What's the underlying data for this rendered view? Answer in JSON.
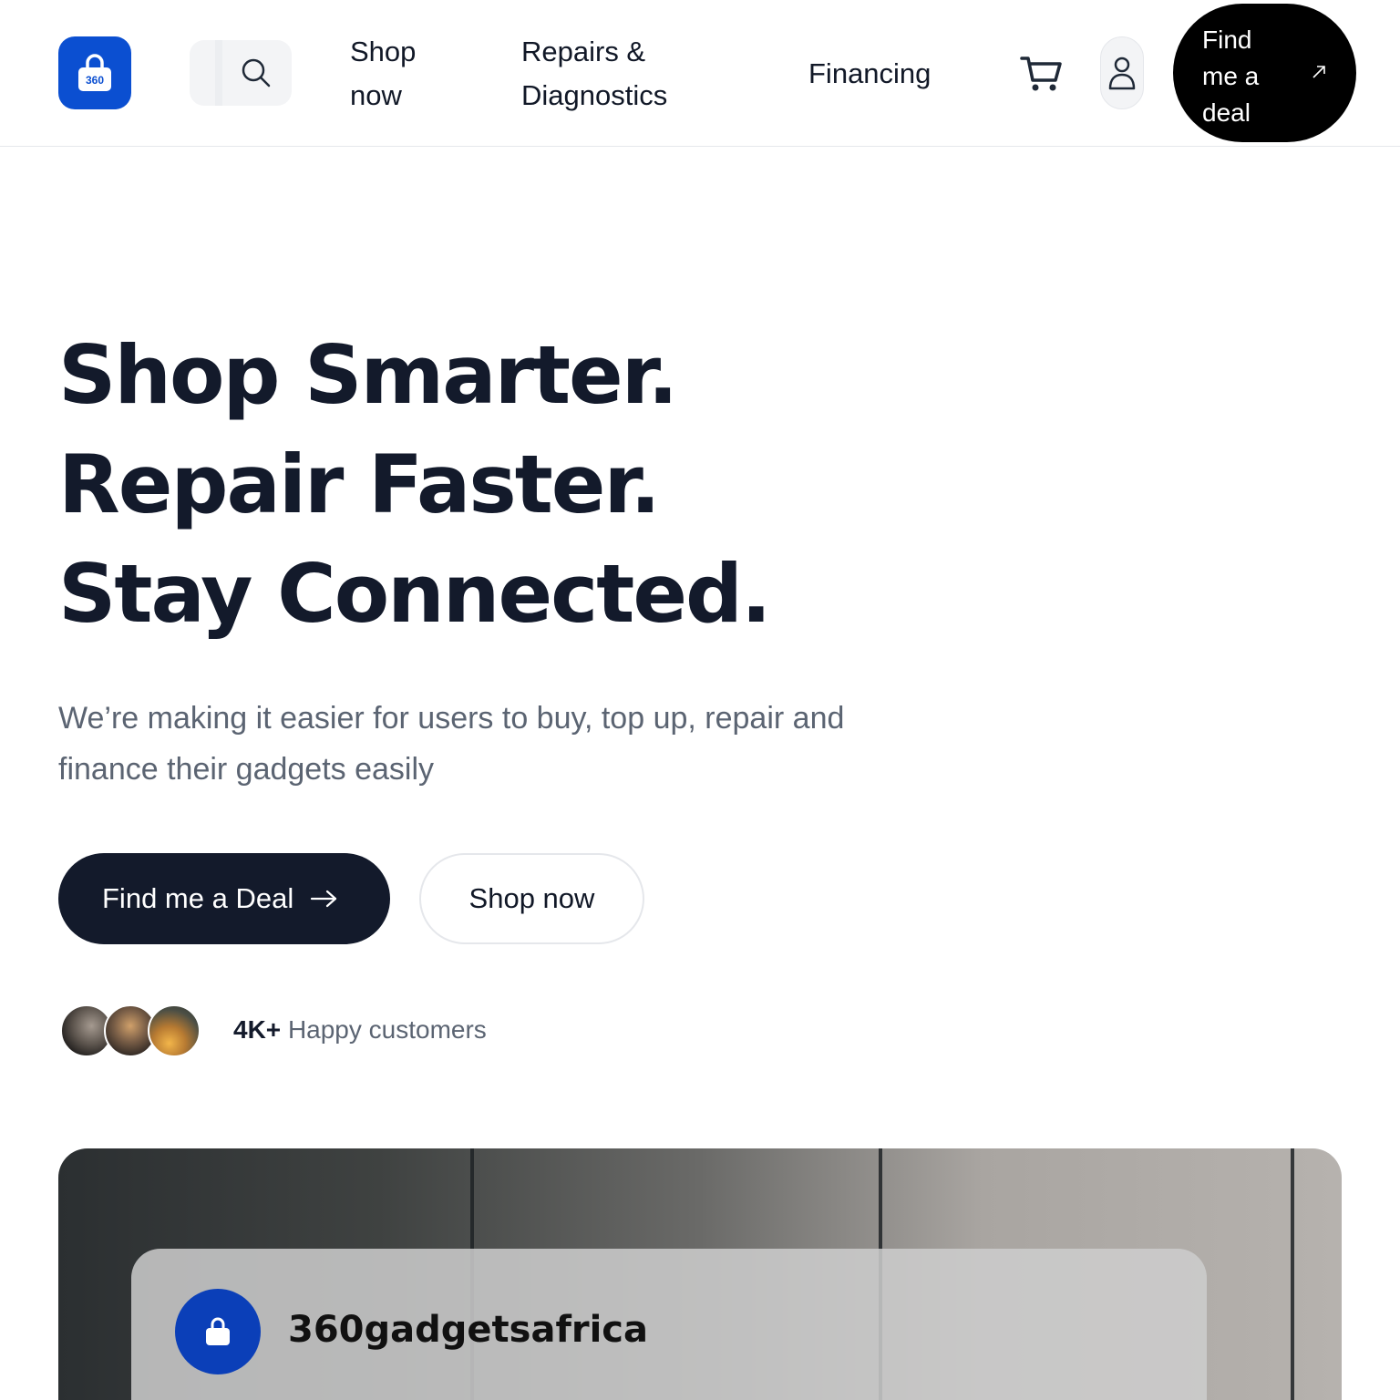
{
  "header": {
    "logo_text": "360",
    "nav": {
      "shop_now": "Shop now",
      "repairs": "Repairs & Diagnostics",
      "financing": "Financing"
    },
    "deal_button": "Find me a deal"
  },
  "hero": {
    "headline": [
      "Shop Smarter.",
      "Repair Faster.",
      "Stay Connected."
    ],
    "subtitle": "We’re making it easier for users to buy, top up, repair and finance their gadgets easily",
    "primary_cta": "Find me a Deal",
    "secondary_cta": "Shop now",
    "customers_count": "4K+",
    "customers_label": "Happy customers"
  },
  "showcase": {
    "brand_name": "360gadgetsafrica"
  },
  "colors": {
    "brand_blue": "#0b4fd1",
    "dark_navy": "#131a2b",
    "muted_text": "#5b6472"
  },
  "icons": [
    "search-icon",
    "cart-icon",
    "user-icon",
    "arrow-up-right-icon",
    "arrow-right-icon",
    "shopping-bag-icon"
  ]
}
